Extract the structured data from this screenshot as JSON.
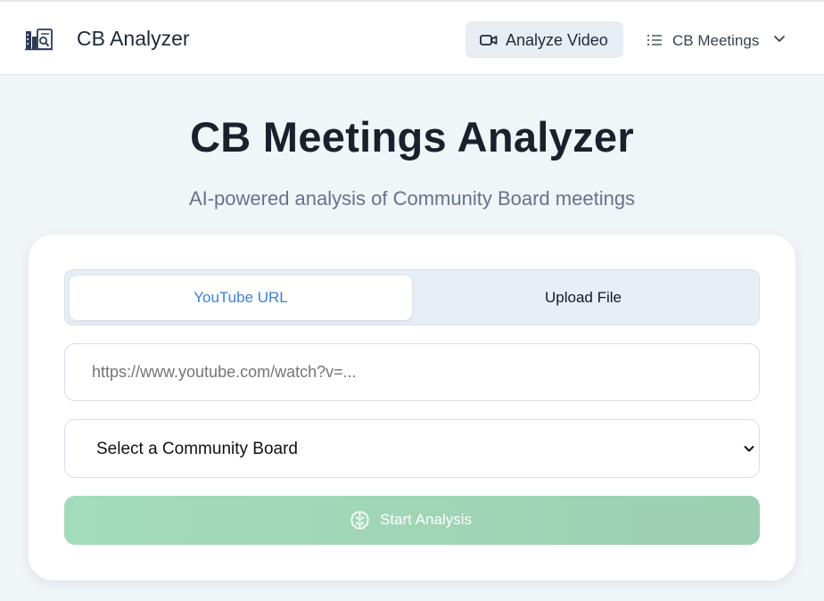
{
  "header": {
    "app_title": "CB Analyzer",
    "logo_icon": "building-analysis-icon",
    "nav": {
      "analyze_label": "Analyze Video",
      "analyze_icon": "video-camera-icon",
      "meetings_label": "CB Meetings",
      "meetings_icon": "list-icon"
    }
  },
  "hero": {
    "title": "CB Meetings Analyzer",
    "subtitle": "AI-powered analysis of Community Board meetings"
  },
  "form": {
    "tabs": [
      {
        "label": "YouTube URL",
        "active": true
      },
      {
        "label": "Upload File",
        "active": false
      }
    ],
    "url_input": {
      "value": "",
      "placeholder": "https://www.youtube.com/watch?v=..."
    },
    "board_select": {
      "selected": "Select a Community Board"
    },
    "submit": {
      "label": "Start Analysis",
      "icon": "brain-icon",
      "enabled": false
    }
  },
  "colors": {
    "accent": "#3b82d6",
    "submit_bg": "#a3dcbb",
    "page_bg": "#f0f5f8"
  }
}
